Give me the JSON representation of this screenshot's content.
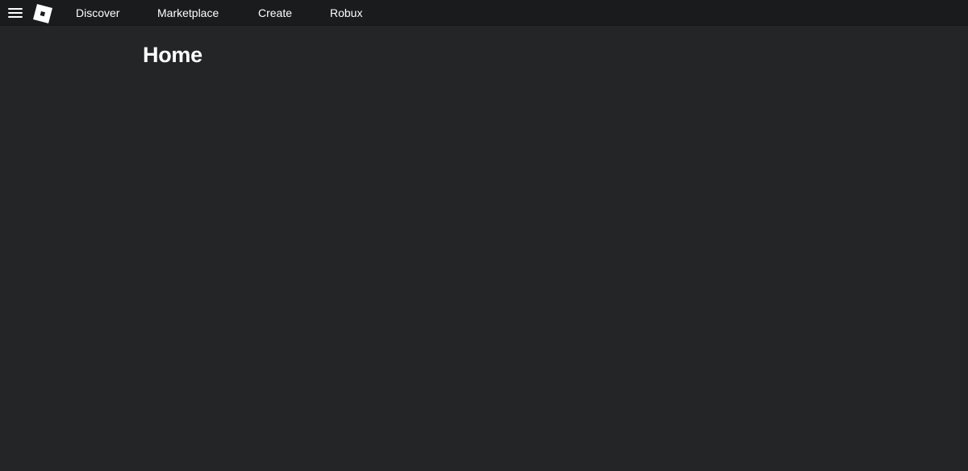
{
  "header": {
    "menu_icon": "hamburger-menu-icon",
    "logo_icon": "roblox-logo-icon",
    "nav": {
      "discover": "Discover",
      "marketplace": "Marketplace",
      "create": "Create",
      "robux": "Robux"
    }
  },
  "main": {
    "title": "Home"
  },
  "colors": {
    "page_background": "#232527",
    "header_background": "#191b1d",
    "text": "#ffffff"
  }
}
